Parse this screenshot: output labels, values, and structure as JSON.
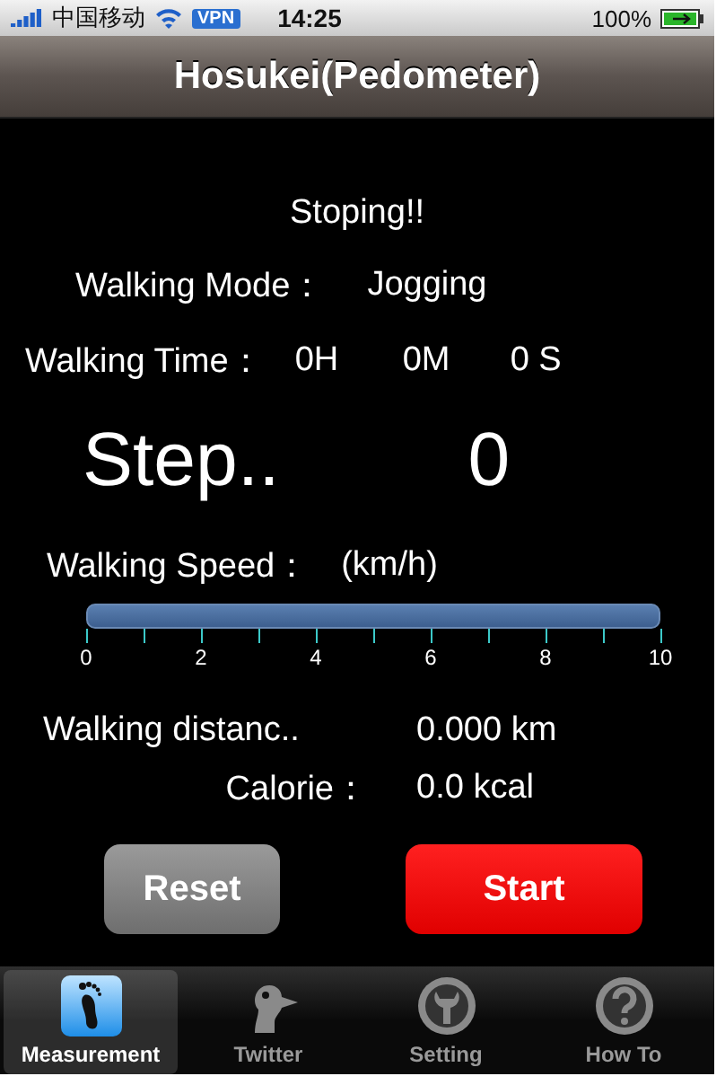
{
  "status_bar": {
    "carrier": "中国移动",
    "vpn": "VPN",
    "time": "14:25",
    "battery": "100%"
  },
  "nav_bar": {
    "title": "Hosukei(Pedometer)"
  },
  "status_text": "Stoping!!",
  "walking_mode": {
    "label": "Walking Mode：",
    "value": "Jogging"
  },
  "walking_time": {
    "label": "Walking Time：",
    "hours": "0H",
    "minutes": "0M",
    "seconds": "0 S"
  },
  "steps": {
    "label": "Step..",
    "value": "0"
  },
  "walking_speed": {
    "label": "Walking Speed：",
    "unit": "(km/h)",
    "scale": [
      "0",
      "2",
      "4",
      "6",
      "8",
      "10"
    ]
  },
  "distance": {
    "label": "Walking distanc..",
    "value": "0.000 km"
  },
  "calorie": {
    "label": "Calorie：",
    "value": "0.0 kcal"
  },
  "buttons": [
    {
      "label": "Reset",
      "kind": "secondary"
    },
    {
      "label": "Start",
      "kind": "primary"
    }
  ],
  "tabs": [
    {
      "label": "Measurement",
      "kind": "foot",
      "selected": true
    },
    {
      "label": "Twitter",
      "kind": "bird",
      "selected": false
    },
    {
      "label": "Setting",
      "kind": "wrench",
      "selected": false
    },
    {
      "label": "How To",
      "kind": "question",
      "selected": false
    }
  ]
}
